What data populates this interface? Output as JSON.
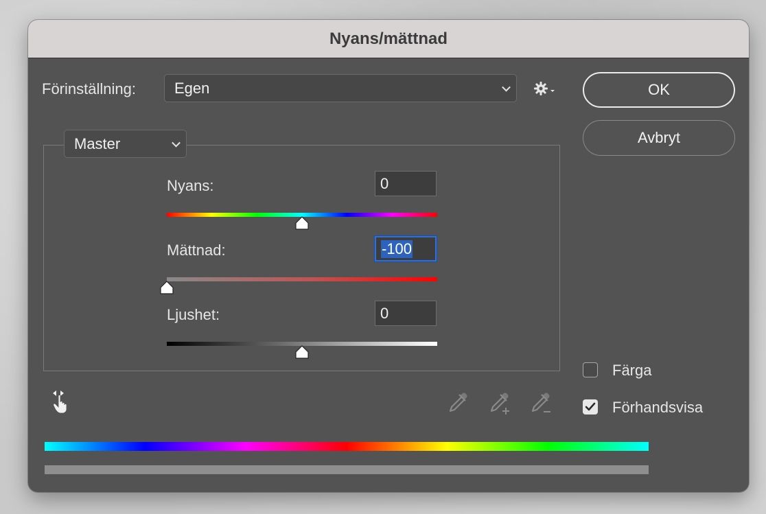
{
  "window": {
    "title": "Nyans/mättnad"
  },
  "preset": {
    "label": "Förinställning:",
    "value": "Egen",
    "settings_icon": "gear-icon"
  },
  "buttons": {
    "ok": "OK",
    "cancel": "Avbryt"
  },
  "channel": {
    "value": "Master"
  },
  "sliders": {
    "hue": {
      "label": "Nyans:",
      "value": "0",
      "level": 0.5
    },
    "saturation": {
      "label": "Mättnad:",
      "value": "-100",
      "level": 0.0
    },
    "lightness": {
      "label": "Ljushet:",
      "value": "0",
      "level": 0.5
    }
  },
  "tools": {
    "targeted_adjust": "hand-adjust-icon",
    "eyedropper": "eyedropper-icon",
    "eyedropper_add": "eyedropper-add-icon",
    "eyedropper_subtract": "eyedropper-subtract-icon"
  },
  "options": {
    "colorize": {
      "label": "Färga",
      "checked": false
    },
    "preview": {
      "label": "Förhandsvisa",
      "checked": true
    }
  },
  "colors": {
    "dialog_bg": "#535353",
    "titlebar_bg": "#d8d4d4",
    "focus_blue": "#2f6fd6"
  }
}
